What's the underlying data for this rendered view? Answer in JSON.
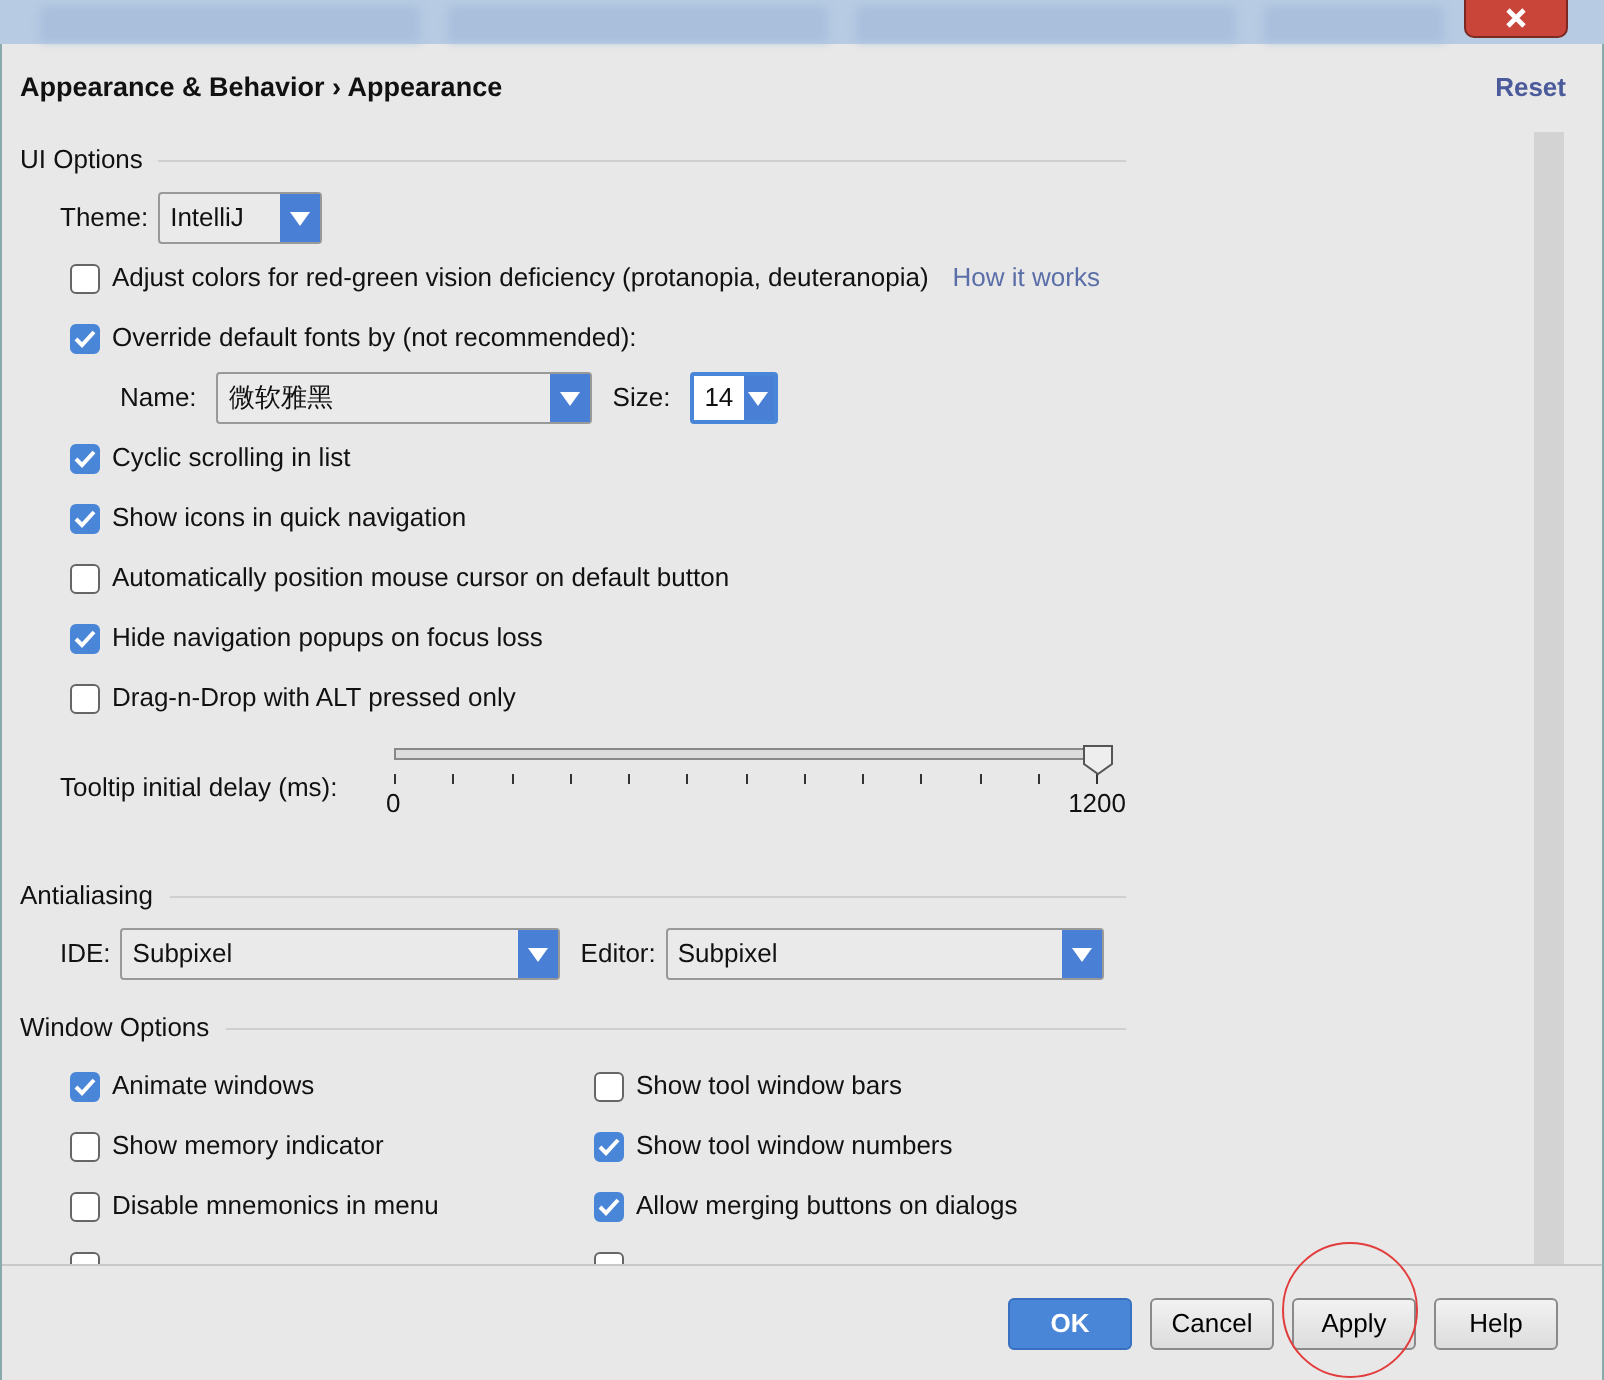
{
  "breadcrumb": {
    "parent": "Appearance & Behavior",
    "separator": "›",
    "current": "Appearance"
  },
  "reset_link": "Reset",
  "sections": [
    {
      "title": "UI Options",
      "items": [
        {
          "kind": "select",
          "label": "Theme:",
          "value": "IntelliJ"
        },
        {
          "kind": "checkbox",
          "label": "Adjust colors for red-green vision deficiency (protanopia, deuteranopia)",
          "checked": false,
          "link": "How it works"
        },
        {
          "kind": "checkbox",
          "label": "Override default fonts by (not recommended):",
          "checked": true
        },
        {
          "kind": "font",
          "name_label": "Name:",
          "name_value": "微软雅黑",
          "size_label": "Size:",
          "size_value": "14"
        },
        {
          "kind": "checkbox",
          "label": "Cyclic scrolling in list",
          "checked": true
        },
        {
          "kind": "checkbox",
          "label": "Show icons in quick navigation",
          "checked": true
        },
        {
          "kind": "checkbox",
          "label": "Automatically position mouse cursor on default button",
          "checked": false
        },
        {
          "kind": "checkbox",
          "label": "Hide navigation popups on focus loss",
          "checked": true
        },
        {
          "kind": "checkbox",
          "label": "Drag-n-Drop with ALT pressed only",
          "checked": false
        },
        {
          "kind": "slider",
          "label": "Tooltip initial delay (ms):",
          "level": 1,
          "min_label": "0",
          "max_label": "1200"
        }
      ]
    },
    {
      "title": "Antialiasing",
      "items": [
        {
          "kind": "selects",
          "fields": [
            {
              "label": "IDE:",
              "value": "Subpixel"
            },
            {
              "label": "Editor:",
              "value": "Subpixel"
            }
          ]
        }
      ]
    },
    {
      "title": "Window Options",
      "items": [
        {
          "kind": "grid",
          "columns": [
            [
              {
                "label": "Animate windows",
                "checked": true
              },
              {
                "label": "Show memory indicator",
                "checked": false
              },
              {
                "label": "Disable mnemonics in menu",
                "checked": false
              },
              {
                "checked": false
              }
            ],
            [
              {
                "label": "Show tool window bars",
                "checked": false
              },
              {
                "label": "Show tool window numbers",
                "checked": true
              },
              {
                "label": "Allow merging buttons on dialogs",
                "checked": true
              },
              {
                "checked": false
              }
            ]
          ]
        }
      ]
    }
  ],
  "buttons": [
    {
      "label": "OK",
      "default": true
    },
    {
      "label": "Cancel",
      "default": false
    },
    {
      "label": "Apply",
      "default": false
    },
    {
      "label": "Help",
      "default": false
    }
  ]
}
